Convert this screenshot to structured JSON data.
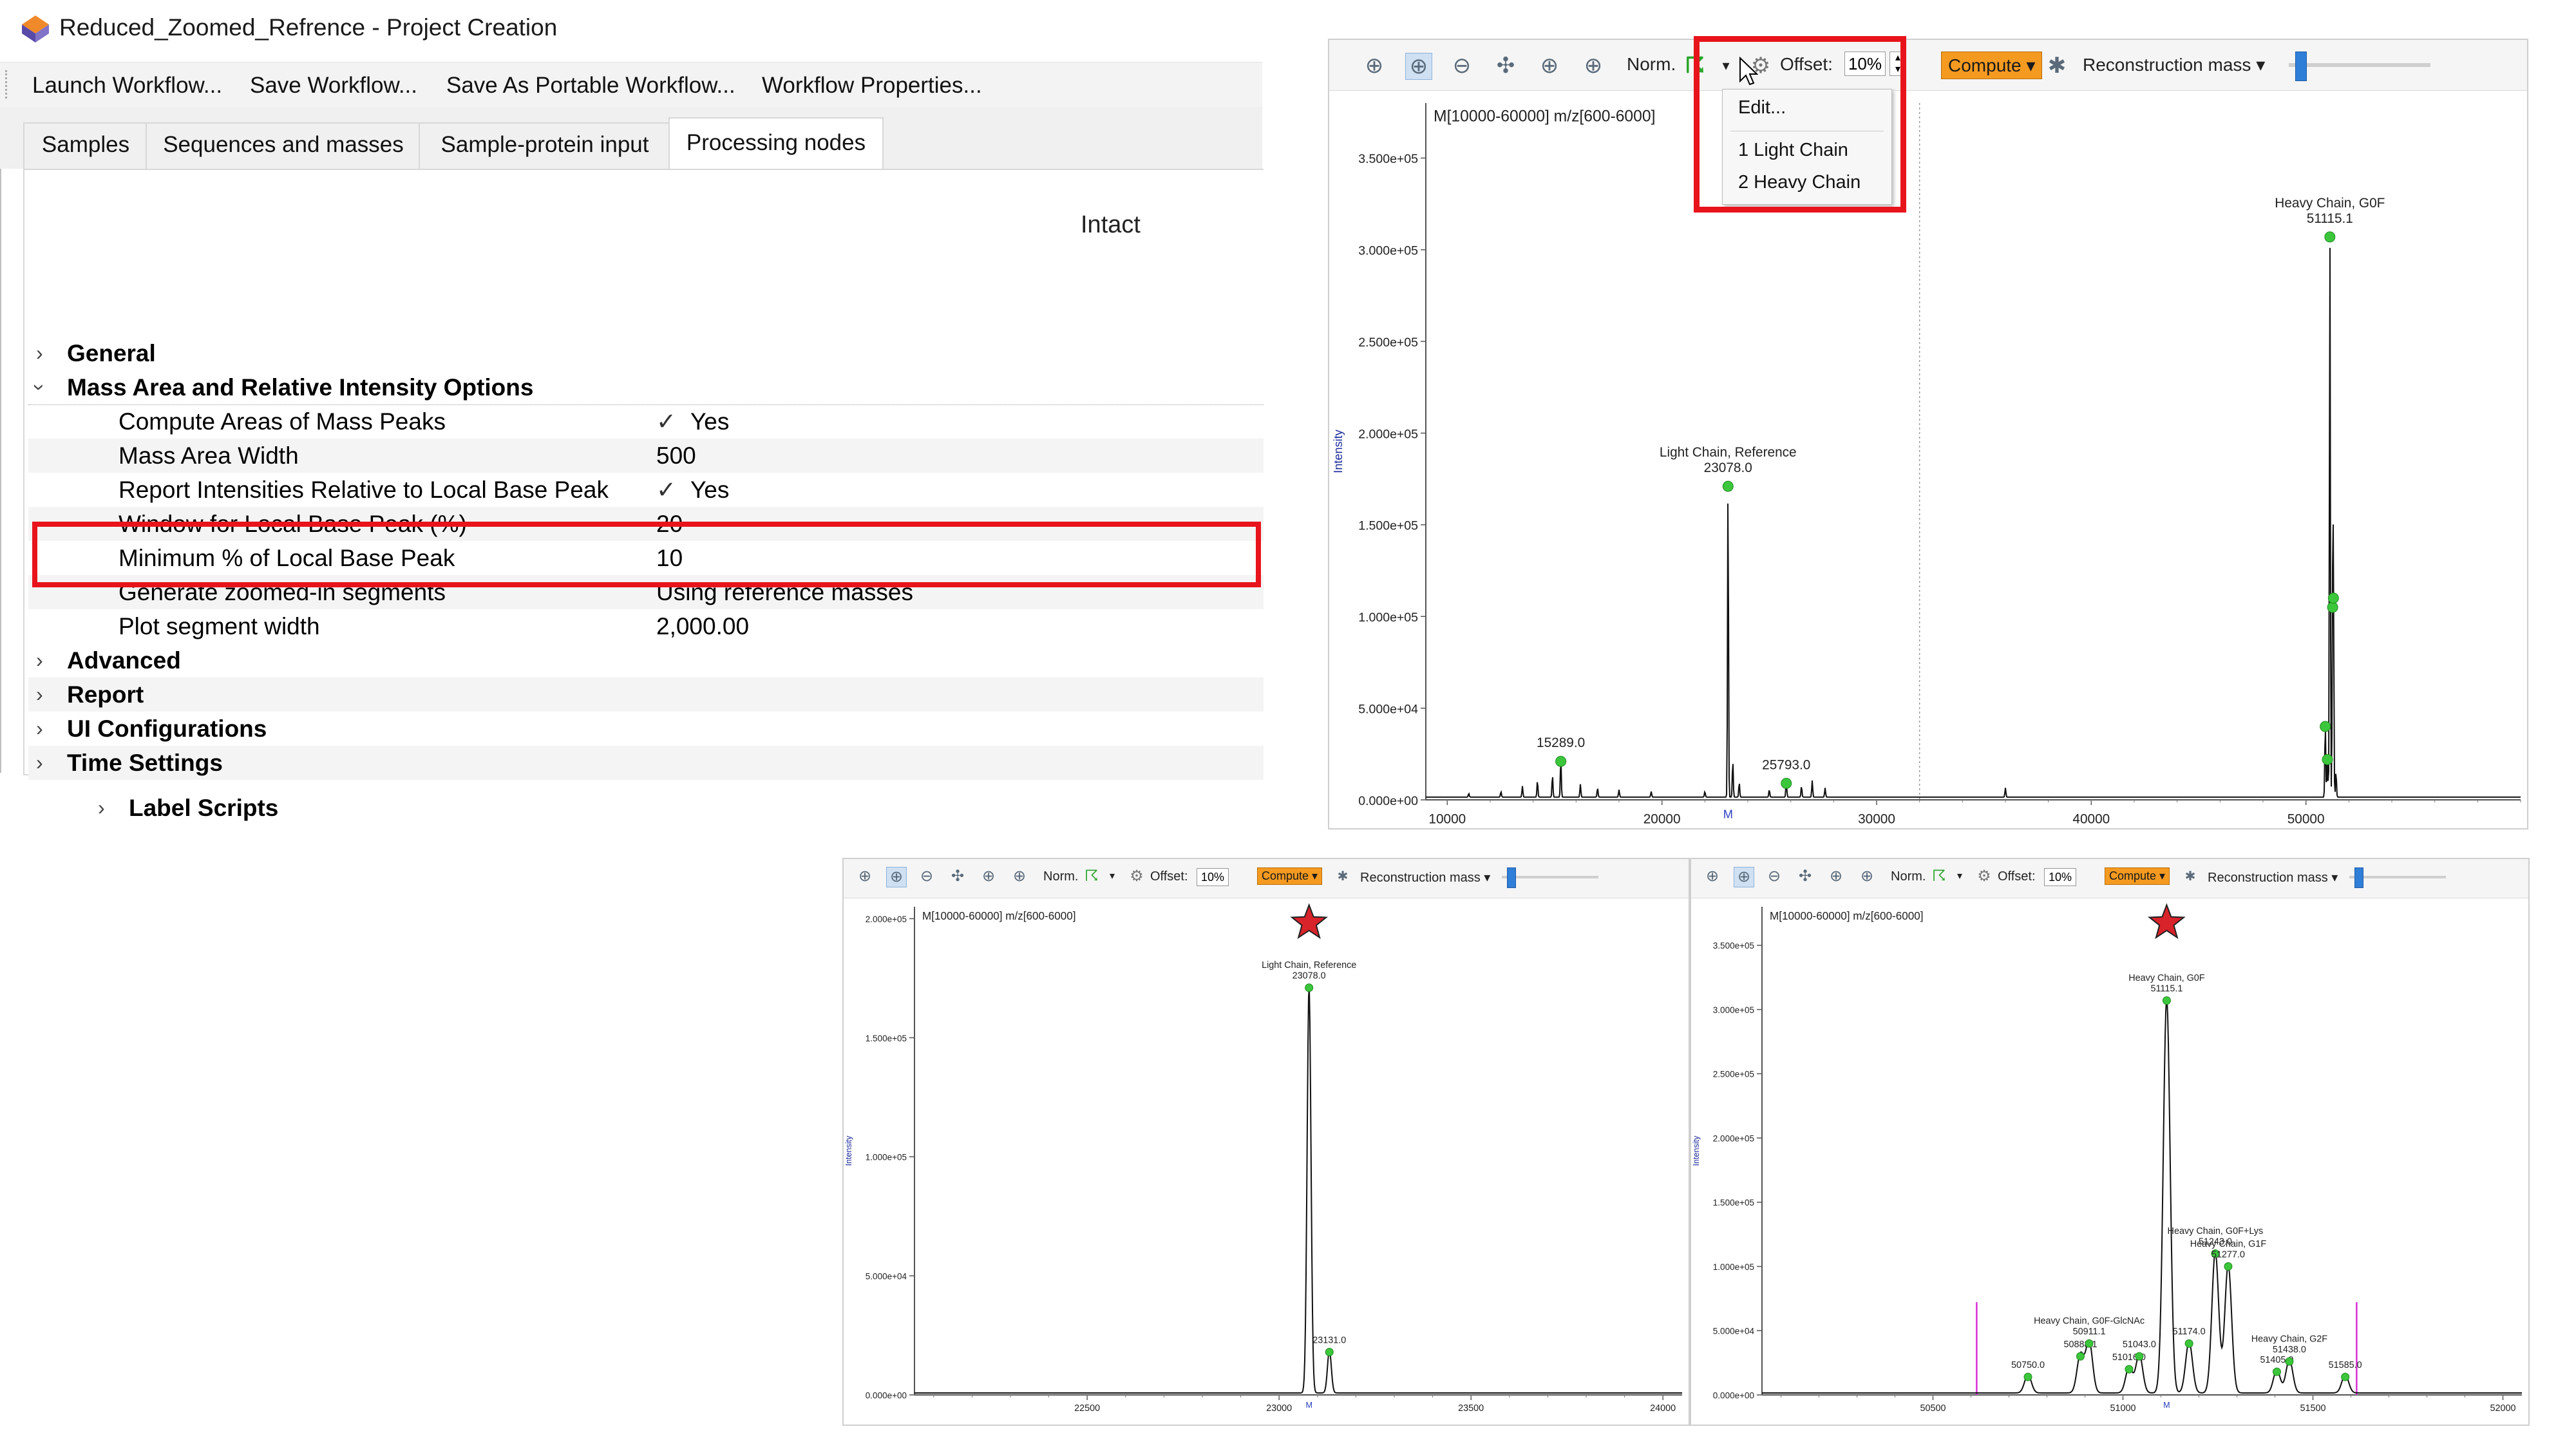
{
  "project_window": {
    "title": "Reduced_Zoomed_Refrence - Project Creation",
    "toolbar": [
      "Launch Workflow...",
      "Save Workflow...",
      "Save As Portable Workflow...",
      "Workflow Properties..."
    ],
    "tabs": [
      "Samples",
      "Sequences and masses",
      "Sample-protein input",
      "Processing nodes"
    ],
    "active_tab": "Processing nodes",
    "node_header": "Intact",
    "groups_top": [
      {
        "label": "General",
        "expanded": false
      },
      {
        "label": "Mass Area and Relative Intensity Options",
        "expanded": true
      }
    ],
    "options": [
      {
        "label": "Compute Areas of Mass Peaks",
        "check": "✓",
        "value": "Yes"
      },
      {
        "label": "Mass Area Width",
        "check": "",
        "value": "500"
      },
      {
        "label": "Report Intensities Relative to Local Base Peak",
        "check": "✓",
        "value": "Yes"
      },
      {
        "label": "Window for Local Base Peak (%)",
        "check": "",
        "value": "20"
      },
      {
        "label": "Minimum % of Local Base Peak",
        "check": "",
        "value": "10"
      },
      {
        "label": "Generate zoomed-in segments",
        "check": "",
        "value": "Using reference masses"
      },
      {
        "label": "Plot segment width",
        "check": "",
        "value": "2,000.00"
      }
    ],
    "groups_bottom": [
      "Advanced",
      "Report",
      "UI Configurations",
      "Time Settings",
      "Label Scripts"
    ]
  },
  "toolbar_common": {
    "norm_label": "Norm.",
    "offset_label": "Offset:",
    "offset_value": "10%",
    "compute_label": "Compute",
    "reconstruction_label": "Reconstruction mass"
  },
  "dropdown_menu": {
    "items": [
      "Edit...",
      "1 Light Chain",
      "2 Heavy Chain"
    ]
  },
  "chart_data": [
    {
      "type": "line",
      "panel": "full-range",
      "title": "M[10000-60000] m/z[600-6000]",
      "ylabel": "Intensity",
      "xlim": [
        9000,
        60000
      ],
      "ylim": [
        0,
        380000
      ],
      "x_ticks": [
        "10000",
        "20000",
        "30000",
        "40000",
        "50000"
      ],
      "x_tick_values": [
        10000,
        20000,
        30000,
        40000,
        50000
      ],
      "y_ticks": [
        "0.000e+00",
        "5.000e+04",
        "1.000e+05",
        "1.500e+05",
        "2.000e+05",
        "2.500e+05",
        "3.000e+05",
        "3.500e+05"
      ],
      "y_tick_values": [
        0,
        50000,
        100000,
        150000,
        200000,
        250000,
        300000,
        350000
      ],
      "axis_marker": "M",
      "axis_marker_x": 23078,
      "divider_x": 32000,
      "peaks": [
        {
          "x": 15289.0,
          "y": 21000,
          "label": "15289.0"
        },
        {
          "x": 23078.0,
          "y": 171000,
          "label": "Light Chain, Reference\n23078.0"
        },
        {
          "x": 25793.0,
          "y": 9000,
          "label": "25793.0"
        },
        {
          "x": 51115.1,
          "y": 307000,
          "label": "Heavy Chain, G0F\n51115.1"
        }
      ],
      "minor_peaks": [
        [
          11000,
          2000
        ],
        [
          12500,
          3000
        ],
        [
          13500,
          6000
        ],
        [
          14200,
          9000
        ],
        [
          14900,
          12000
        ],
        [
          16200,
          7000
        ],
        [
          17000,
          5000
        ],
        [
          18000,
          4000
        ],
        [
          19500,
          3000
        ],
        [
          22000,
          3000
        ],
        [
          23300,
          20000
        ],
        [
          23600,
          8000
        ],
        [
          25000,
          4000
        ],
        [
          26500,
          6000
        ],
        [
          27000,
          9000
        ],
        [
          27600,
          5000
        ],
        [
          36000,
          5000
        ],
        [
          50900,
          40000
        ],
        [
          51000,
          22000
        ],
        [
          51243,
          105000
        ],
        [
          51280,
          110000
        ],
        [
          51400,
          14000
        ]
      ]
    },
    {
      "type": "line",
      "panel": "zoom-light-chain",
      "title": "M[10000-60000] m/z[600-6000]",
      "ylabel": "Intensity",
      "xlim": [
        22050,
        24050
      ],
      "ylim": [
        0,
        205000
      ],
      "x_ticks": [
        "22500",
        "23000",
        "23500",
        "24000"
      ],
      "x_tick_values": [
        22500,
        23000,
        23500,
        24000
      ],
      "y_ticks": [
        "0.000e+00",
        "5.000e+04",
        "1.000e+05",
        "1.500e+05",
        "2.000e+05"
      ],
      "y_tick_values": [
        0,
        50000,
        100000,
        150000,
        200000
      ],
      "axis_marker": "M",
      "axis_marker_x": 23078,
      "star_x": 23078,
      "peaks": [
        {
          "x": 23078.0,
          "y": 171000,
          "label": "Light Chain, Reference\n23078.0"
        },
        {
          "x": 23131.0,
          "y": 18000,
          "label": "23131.0"
        }
      ]
    },
    {
      "type": "line",
      "panel": "zoom-heavy-chain",
      "title": "M[10000-60000] m/z[600-6000]",
      "ylabel": "Intensity",
      "xlim": [
        50050,
        52050
      ],
      "ylim": [
        0,
        380000
      ],
      "x_ticks": [
        "50500",
        "51000",
        "51500",
        "52000"
      ],
      "x_tick_values": [
        50500,
        51000,
        51500,
        52000
      ],
      "y_ticks": [
        "0.000e+00",
        "5.000e+04",
        "1.000e+05",
        "1.500e+05",
        "2.000e+05",
        "2.500e+05",
        "3.000e+05",
        "3.500e+05"
      ],
      "y_tick_values": [
        0,
        50000,
        100000,
        150000,
        200000,
        250000,
        300000,
        350000
      ],
      "axis_marker": "M",
      "axis_marker_x": 51115,
      "star_x": 51115,
      "window_lines": [
        50615,
        51615
      ],
      "peaks": [
        {
          "x": 50750.0,
          "y": 14000,
          "label": "50750.0"
        },
        {
          "x": 50888.1,
          "y": 30000,
          "label": "50888.1"
        },
        {
          "x": 50911.1,
          "y": 40000,
          "label": "Heavy Chain, G0F-GlcNAc\n50911.1"
        },
        {
          "x": 51016.0,
          "y": 20000,
          "label": "51016.0"
        },
        {
          "x": 51043.0,
          "y": 30000,
          "label": "51043.0"
        },
        {
          "x": 51115.1,
          "y": 307000,
          "label": "Heavy Chain, G0F\n51115.1"
        },
        {
          "x": 51174.0,
          "y": 40000,
          "label": "51174.0"
        },
        {
          "x": 51243.0,
          "y": 110000,
          "label": "Heavy Chain, G0F+Lys\n51243.0"
        },
        {
          "x": 51277.0,
          "y": 100000,
          "label": "Heavy Chain, G1F\n51277.0"
        },
        {
          "x": 51405.0,
          "y": 18000,
          "label": "51405.0"
        },
        {
          "x": 51438.0,
          "y": 26000,
          "label": "Heavy Chain, G2F\n51438.0"
        },
        {
          "x": 51585.0,
          "y": 14000,
          "label": "51585.0"
        }
      ]
    }
  ],
  "colors": {
    "highlight": "#e8141c",
    "peak_marker": "#3cc63c",
    "star": "#d8232a",
    "window_line": "#d633d6",
    "compute": "#f59a20"
  }
}
